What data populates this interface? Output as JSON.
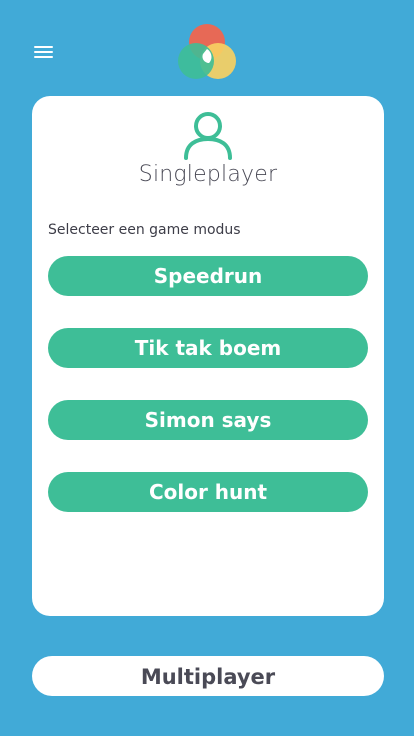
{
  "header": {
    "menu_icon": "hamburger-menu-icon",
    "logo_icon": "color-circles-logo-icon"
  },
  "card": {
    "icon": "user-icon",
    "title": "Singleplayer",
    "subtitle": "Selecteer een game modus",
    "modes": [
      {
        "label": "Speedrun"
      },
      {
        "label": "Tik tak boem"
      },
      {
        "label": "Simon says"
      },
      {
        "label": "Color hunt"
      }
    ]
  },
  "footer": {
    "multiplayer_label": "Multiplayer"
  },
  "colors": {
    "background": "#41aad7",
    "accent": "#3ebe97",
    "card": "#ffffff",
    "text_dark": "#4a4a56",
    "logo_red": "#f0654f",
    "logo_yellow": "#f7d062",
    "logo_green": "#3ebe97"
  }
}
